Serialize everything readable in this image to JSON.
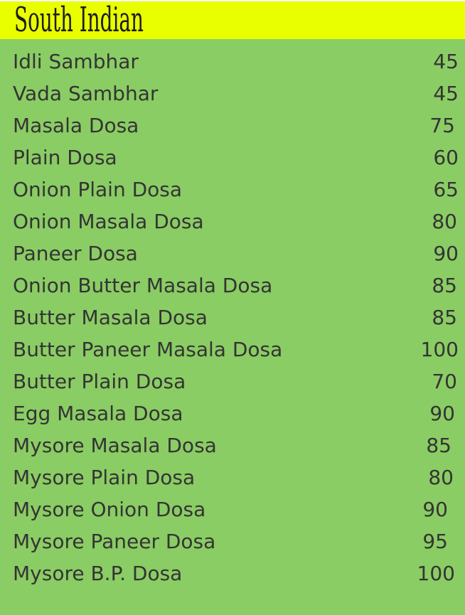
{
  "section": {
    "title": "South Indian",
    "colors": {
      "header_bg": "#e9ff00",
      "page_bg": "#8acd64",
      "text": "#343434"
    }
  },
  "menu": {
    "items": [
      {
        "name": "Idli Sambhar",
        "price": "45"
      },
      {
        "name": "Vada Sambhar",
        "price": "45"
      },
      {
        "name": "Masala Dosa",
        "price": "75"
      },
      {
        "name": "Plain Dosa",
        "price": "60"
      },
      {
        "name": "Onion Plain Dosa",
        "price": "65"
      },
      {
        "name": "Onion Masala Dosa",
        "price": "80"
      },
      {
        "name": "Paneer Dosa",
        "price": "90"
      },
      {
        "name": "Onion Butter Masala Dosa",
        "price": "85"
      },
      {
        "name": "Butter Masala Dosa",
        "price": "85"
      },
      {
        "name": "Butter Paneer Masala Dosa",
        "price": "100"
      },
      {
        "name": "Butter Plain Dosa",
        "price": "70"
      },
      {
        "name": "Egg Masala Dosa",
        "price": "90"
      },
      {
        "name": "Mysore Masala Dosa",
        "price": "85"
      },
      {
        "name": "Mysore Plain Dosa",
        "price": "80"
      },
      {
        "name": "Mysore Onion Dosa",
        "price": "90"
      },
      {
        "name": "Mysore Paneer Dosa",
        "price": "95"
      },
      {
        "name": "Mysore B.P. Dosa",
        "price": "100"
      }
    ]
  }
}
